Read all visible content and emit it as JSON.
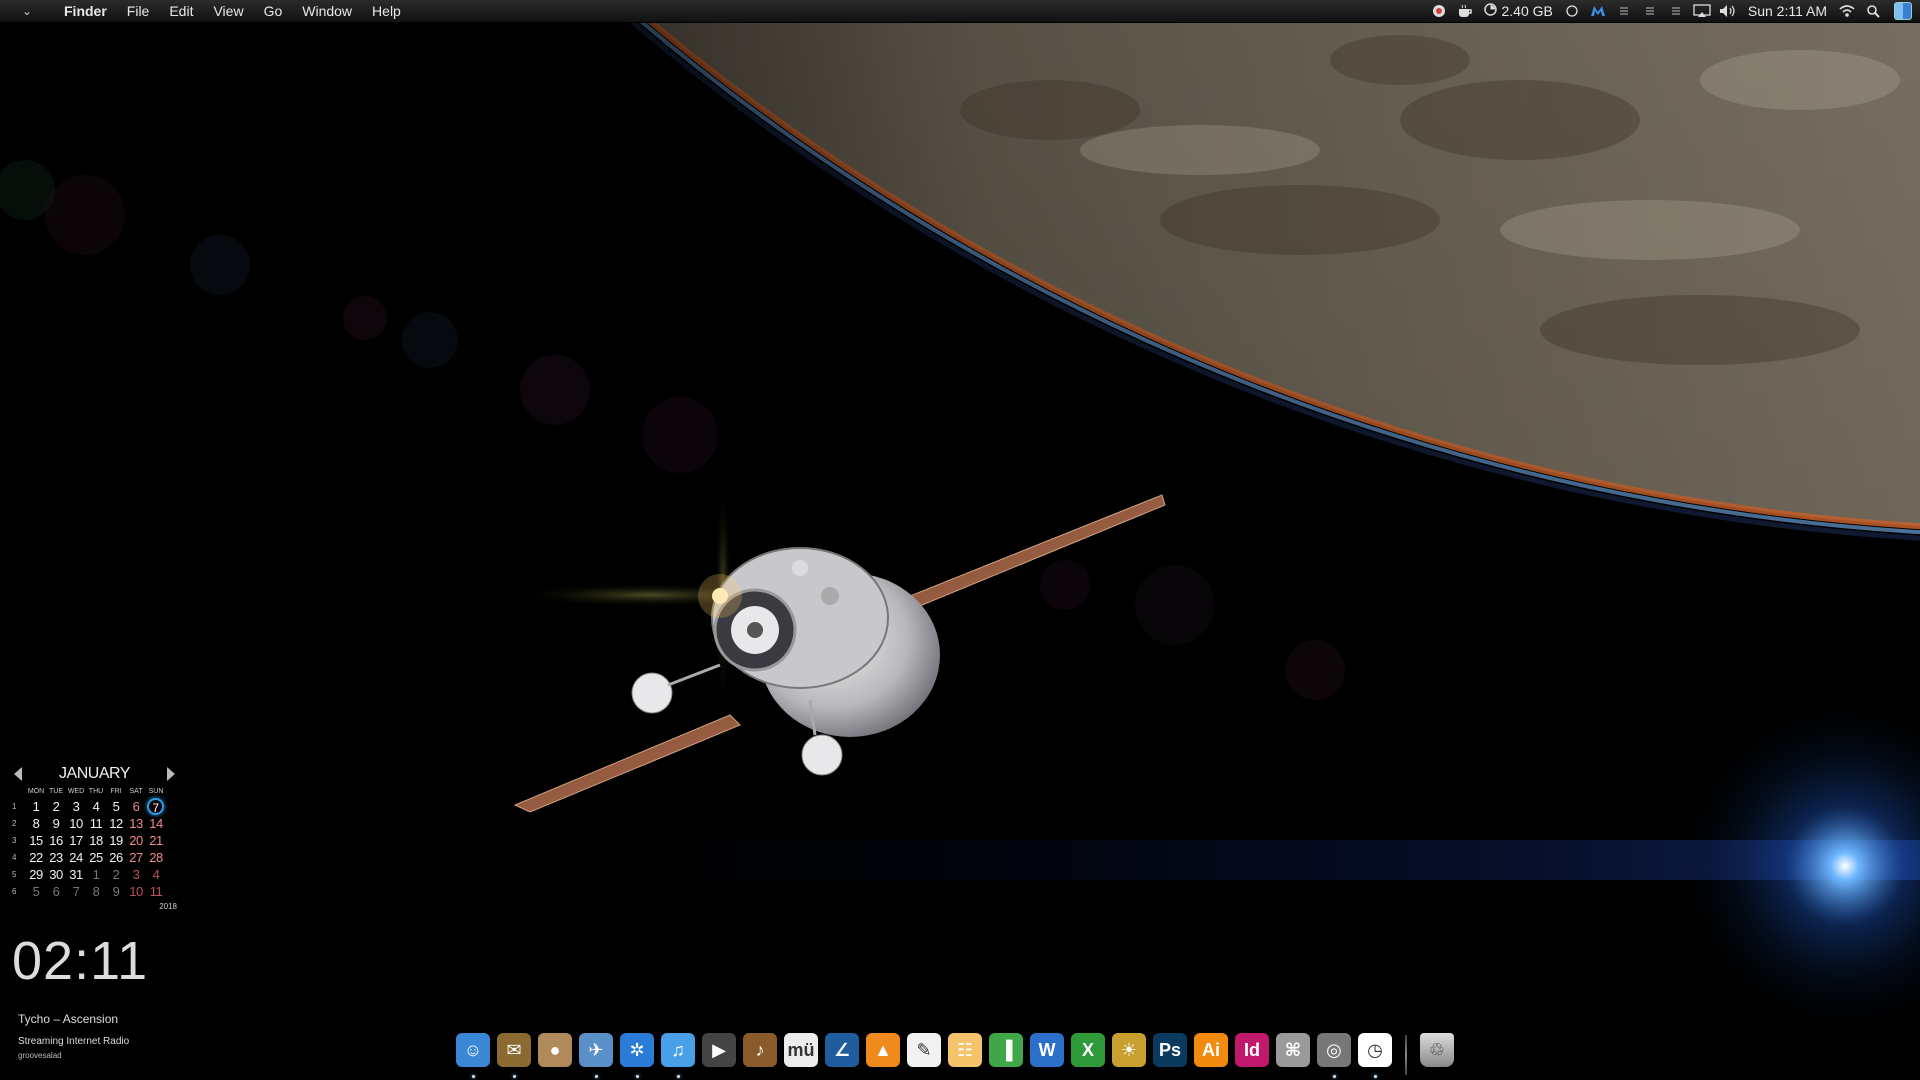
{
  "menubar": {
    "apple_symbol": "⌄",
    "app_name": "Finder",
    "menus": [
      "File",
      "Edit",
      "View",
      "Go",
      "Window",
      "Help"
    ],
    "status": {
      "memory": "2.40 GB",
      "datetime": "Sun 2:11 AM"
    },
    "icons": [
      "record-icon",
      "coffee-icon",
      "memory-icon",
      "circle-icon",
      "malwarebytes-icon",
      "dropbox-icon",
      "dropbox-icon",
      "dropbox-icon",
      "airplay-icon",
      "volume-icon",
      "wifi-icon",
      "spotlight-icon",
      "finder-icon"
    ]
  },
  "calendar": {
    "month": "JANUARY",
    "weekdays": [
      "MON",
      "TUE",
      "WED",
      "THU",
      "FRI",
      "SAT",
      "SUN"
    ],
    "weeks": [
      {
        "num": "1",
        "days": [
          "1",
          "2",
          "3",
          "4",
          "5",
          "6",
          "7"
        ]
      },
      {
        "num": "2",
        "days": [
          "8",
          "9",
          "10",
          "11",
          "12",
          "13",
          "14"
        ]
      },
      {
        "num": "3",
        "days": [
          "15",
          "16",
          "17",
          "18",
          "19",
          "20",
          "21"
        ]
      },
      {
        "num": "4",
        "days": [
          "22",
          "23",
          "24",
          "25",
          "26",
          "27",
          "28"
        ]
      },
      {
        "num": "5",
        "days": [
          "29",
          "30",
          "31",
          "1",
          "2",
          "3",
          "4"
        ]
      },
      {
        "num": "6",
        "days": [
          "5",
          "6",
          "7",
          "8",
          "9",
          "10",
          "11"
        ]
      }
    ],
    "today": "7",
    "year": "2018"
  },
  "clock": {
    "time": "02:11"
  },
  "nowplaying": {
    "track": "Tycho – Ascension",
    "station": "Streaming Internet Radio",
    "sub": "groovesalad"
  },
  "dock": {
    "items": [
      {
        "name": "finder-icon",
        "label": "",
        "bg": "#3a87d6",
        "glyph": "☺",
        "running": true
      },
      {
        "name": "archive-icon",
        "label": "",
        "bg": "#8a6a30",
        "glyph": "✉",
        "running": true
      },
      {
        "name": "jupiter-icon",
        "label": "",
        "bg": "#b08a5a",
        "glyph": "●",
        "running": false
      },
      {
        "name": "preview-icon",
        "label": "",
        "bg": "#5a8fc7",
        "glyph": "✈",
        "running": true
      },
      {
        "name": "safari-icon",
        "label": "",
        "bg": "#2a7cd6",
        "glyph": "✲",
        "running": true
      },
      {
        "name": "itunes-icon",
        "label": "",
        "bg": "#4aa0e8",
        "glyph": "♫",
        "running": true
      },
      {
        "name": "dvd-player-icon",
        "label": "",
        "bg": "#444",
        "glyph": "▶",
        "running": false
      },
      {
        "name": "garageband-icon",
        "label": "",
        "bg": "#8a5a2a",
        "glyph": "♪",
        "running": false
      },
      {
        "name": "mu-icon",
        "label": "mü",
        "bg": "#ececec",
        "glyph": "",
        "running": false
      },
      {
        "name": "compass-app-icon",
        "label": "",
        "bg": "#1f5d9e",
        "glyph": "∠",
        "running": false
      },
      {
        "name": "vlc-icon",
        "label": "",
        "bg": "#f08a1c",
        "glyph": "▲",
        "running": false
      },
      {
        "name": "textedit-icon",
        "label": "",
        "bg": "#f2f2f2",
        "glyph": "✎",
        "running": false
      },
      {
        "name": "pages-icon",
        "label": "",
        "bg": "#f5c46a",
        "glyph": "☷",
        "running": false
      },
      {
        "name": "numbers-icon",
        "label": "",
        "bg": "#3fa64a",
        "glyph": "▐",
        "running": false
      },
      {
        "name": "word-icon",
        "label": "W",
        "bg": "#2a70c8",
        "glyph": "",
        "running": false
      },
      {
        "name": "excel-icon",
        "label": "X",
        "bg": "#2f9a3a",
        "glyph": "",
        "running": false
      },
      {
        "name": "iphoto-icon",
        "label": "",
        "bg": "#c8a030",
        "glyph": "☀",
        "running": false
      },
      {
        "name": "photoshop-icon",
        "label": "Ps",
        "bg": "#0a3a5e",
        "glyph": "",
        "running": false
      },
      {
        "name": "illustrator-icon",
        "label": "Ai",
        "bg": "#f28a10",
        "glyph": "",
        "running": false
      },
      {
        "name": "indesign-icon",
        "label": "Id",
        "bg": "#c0186a",
        "glyph": "",
        "running": false
      },
      {
        "name": "system-info-icon",
        "label": "",
        "bg": "#9a9a9a",
        "glyph": "⌘",
        "running": false
      },
      {
        "name": "disk-utility-icon",
        "label": "",
        "bg": "#777",
        "glyph": "◎",
        "running": true
      },
      {
        "name": "clock-app-icon",
        "label": "",
        "bg": "#ffffff",
        "glyph": "◷",
        "running": true
      }
    ],
    "trash": {
      "name": "trash-icon",
      "bg": "#aaa",
      "glyph": "♲"
    }
  }
}
